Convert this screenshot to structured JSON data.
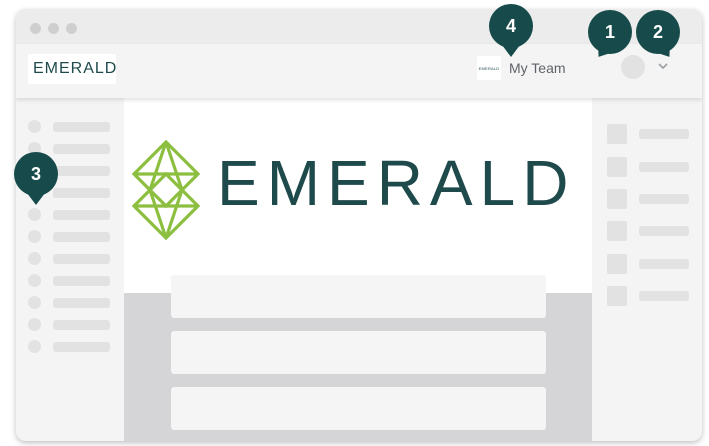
{
  "header": {
    "logo_text": "EMERALD",
    "team_logo_text": "EMERALD",
    "team_name": "My Team"
  },
  "banner": {
    "logo_text": "EMERALD"
  },
  "markers": [
    "1",
    "2",
    "3",
    "4"
  ],
  "colors": {
    "brand_teal": "#1e4a4c",
    "brand_green": "#8cbf3f",
    "marker_bg": "#174b4b"
  },
  "icons": {
    "avatar": "user-avatar-placeholder",
    "dropdown": "chevron-down-icon",
    "logo_mark": "emerald-diamond-icon"
  }
}
